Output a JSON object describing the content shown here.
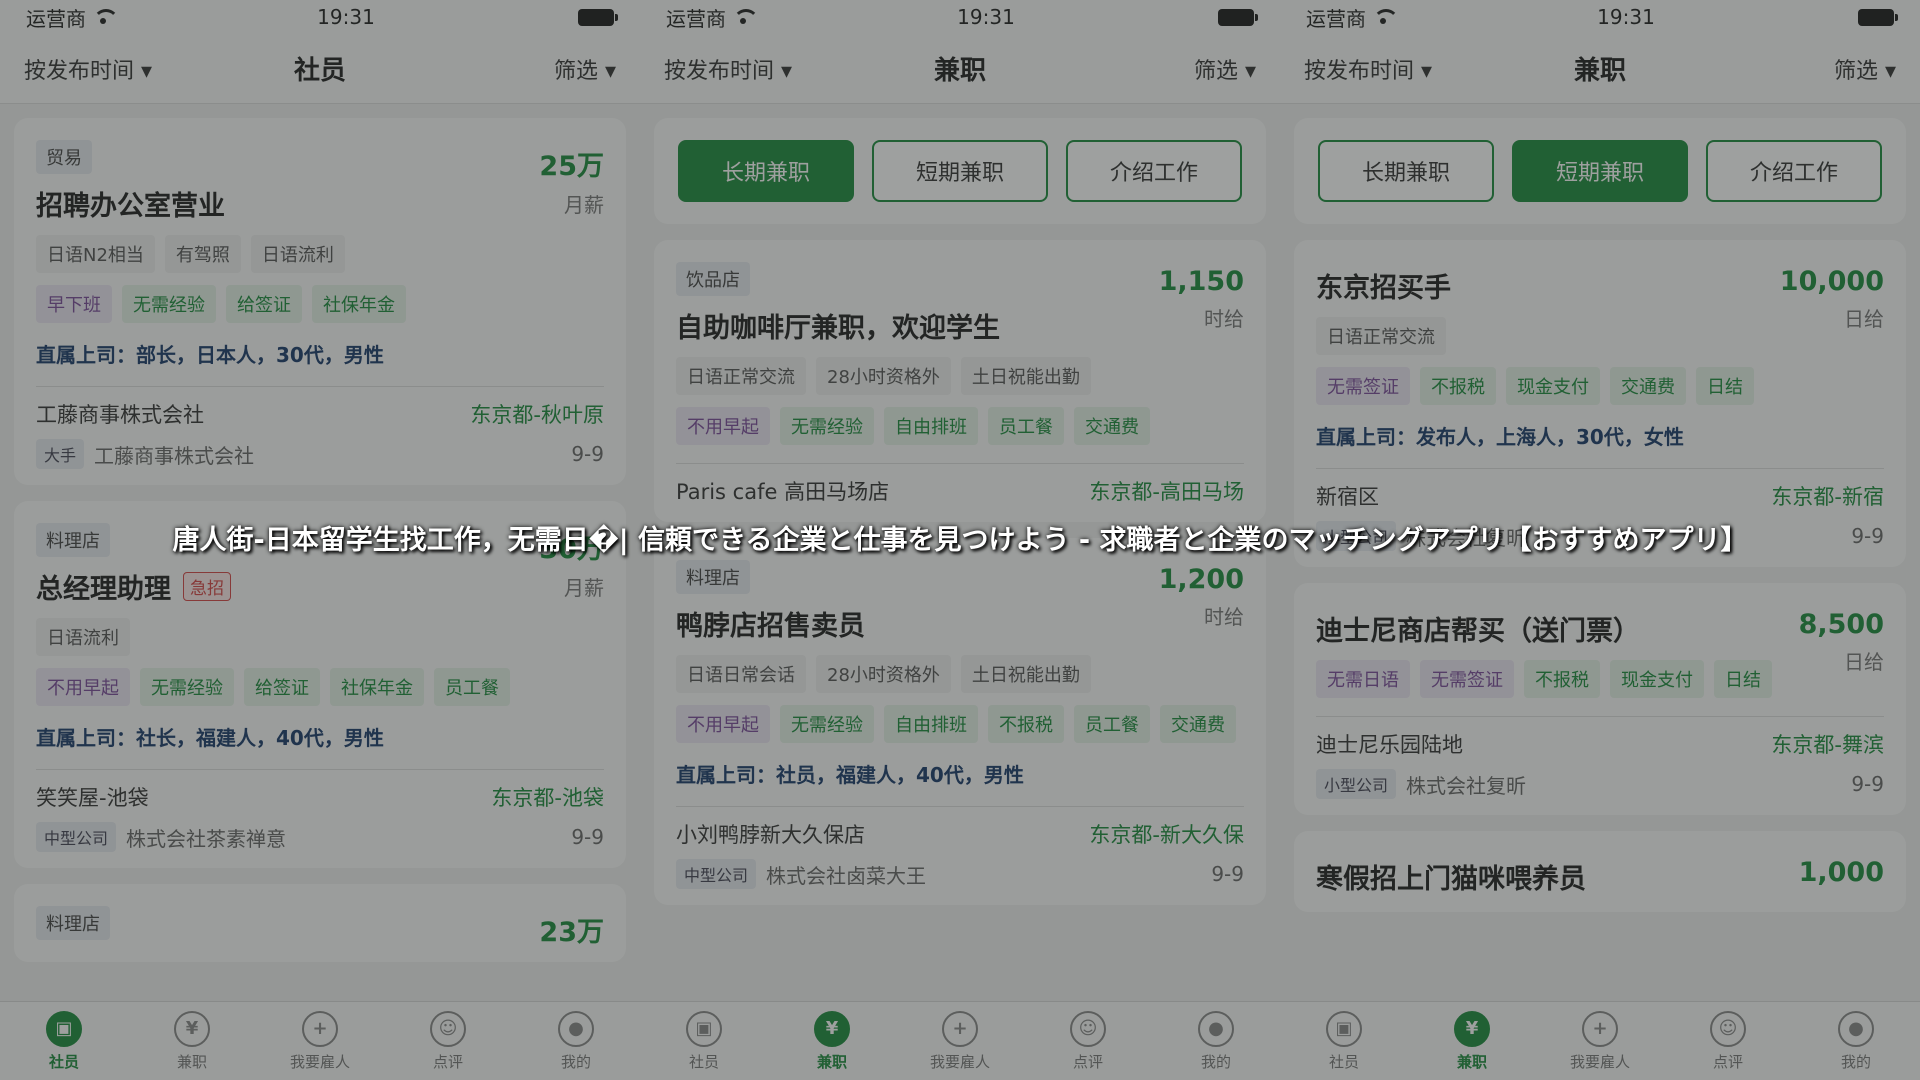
{
  "screens": [
    {
      "status": {
        "carrier": "运营商",
        "time": "19:31"
      },
      "nav": {
        "sort": "按发布时间 ▾",
        "title": "社员",
        "filter": "筛选 ▾"
      },
      "cards": [
        {
          "category": "贸易",
          "title": "招聘办公室营业",
          "salary": "25万",
          "unit": "月薪",
          "req_tags": [
            "日语N2相当",
            "有驾照",
            "日语流利"
          ],
          "benefit_tags": [
            {
              "t": "早下班",
              "c": "purple"
            },
            {
              "t": "无需经验",
              "c": "green"
            },
            {
              "t": "给签证",
              "c": "green"
            },
            {
              "t": "社保年金",
              "c": "green"
            }
          ],
          "boss": "直属上司：部长，日本人，30代，男性",
          "company": "工藤商事株式会社",
          "location": "东京都-秋叶原",
          "size": "大手",
          "company_full": "工藤商事株式会社",
          "hours": "9-9"
        },
        {
          "category": "料理店",
          "title": "总经理助理",
          "urgent": "急招",
          "salary": "30万",
          "unit": "月薪",
          "req_tags": [
            "日语流利"
          ],
          "benefit_tags": [
            {
              "t": "不用早起",
              "c": "purple"
            },
            {
              "t": "无需经验",
              "c": "green"
            },
            {
              "t": "给签证",
              "c": "green"
            },
            {
              "t": "社保年金",
              "c": "green"
            },
            {
              "t": "员工餐",
              "c": "green"
            }
          ],
          "boss": "直属上司：社长，福建人，40代，男性",
          "company": "笑笑屋-池袋",
          "location": "东京都-池袋",
          "size": "中型公司",
          "company_full": "株式会社茶素禅意",
          "hours": "9-9"
        },
        {
          "category": "料理店",
          "salary": "23万"
        }
      ],
      "tabs": [
        {
          "label": "社员",
          "icon": "bag-icon",
          "glyph": "▣"
        },
        {
          "label": "兼职",
          "icon": "yen-icon",
          "glyph": "¥"
        },
        {
          "label": "我要雇人",
          "icon": "plus-icon",
          "glyph": "+"
        },
        {
          "label": "点评",
          "icon": "smile-icon",
          "glyph": "☺"
        },
        {
          "label": "我的",
          "icon": "user-icon",
          "glyph": "●"
        }
      ],
      "active_tab": 0
    },
    {
      "status": {
        "carrier": "运营商",
        "time": "19:31"
      },
      "nav": {
        "sort": "按发布时间 ▾",
        "title": "兼职",
        "filter": "筛选 ▾"
      },
      "segments": [
        "长期兼职",
        "短期兼职",
        "介绍工作"
      ],
      "active_segment": 0,
      "cards": [
        {
          "category": "饮品店",
          "title": "自助咖啡厅兼职，欢迎学生",
          "salary": "1,150",
          "unit": "时给",
          "req_tags": [
            "日语正常交流",
            "28小时资格外",
            "土日祝能出勤"
          ],
          "benefit_tags": [
            {
              "t": "不用早起",
              "c": "purple"
            },
            {
              "t": "无需经验",
              "c": "green"
            },
            {
              "t": "自由排班",
              "c": "green"
            },
            {
              "t": "员工餐",
              "c": "green"
            },
            {
              "t": "交通费",
              "c": "green"
            }
          ],
          "company": "Paris cafe 高田马场店",
          "location": "东京都-高田马场"
        },
        {
          "category": "料理店",
          "title": "鸭脖店招售卖员",
          "salary": "1,200",
          "unit": "时给",
          "req_tags": [
            "日语日常会话",
            "28小时资格外",
            "土日祝能出勤"
          ],
          "benefit_tags": [
            {
              "t": "不用早起",
              "c": "purple"
            },
            {
              "t": "无需经验",
              "c": "green"
            },
            {
              "t": "自由排班",
              "c": "green"
            },
            {
              "t": "不报税",
              "c": "green"
            },
            {
              "t": "员工餐",
              "c": "green"
            },
            {
              "t": "交通费",
              "c": "green"
            }
          ],
          "boss": "直属上司：社员，福建人，40代，男性",
          "company": "小刘鸭脖新大久保店",
          "location": "东京都-新大久保",
          "size": "中型公司",
          "company_full": "株式会社卤菜大王",
          "hours": "9-9"
        }
      ],
      "tabs": [
        {
          "label": "社员",
          "icon": "bag-icon",
          "glyph": "▣"
        },
        {
          "label": "兼职",
          "icon": "yen-icon",
          "glyph": "¥"
        },
        {
          "label": "我要雇人",
          "icon": "plus-icon",
          "glyph": "+"
        },
        {
          "label": "点评",
          "icon": "smile-icon",
          "glyph": "☺"
        },
        {
          "label": "我的",
          "icon": "user-icon",
          "glyph": "●"
        }
      ],
      "active_tab": 1
    },
    {
      "status": {
        "carrier": "运营商",
        "time": "19:31"
      },
      "nav": {
        "sort": "按发布时间 ▾",
        "title": "兼职",
        "filter": "筛选 ▾"
      },
      "segments": [
        "长期兼职",
        "短期兼职",
        "介绍工作"
      ],
      "active_segment": 1,
      "cards": [
        {
          "title": "东京招买手",
          "salary": "10,000",
          "unit": "日给",
          "req_tags": [
            "日语正常交流"
          ],
          "benefit_tags": [
            {
              "t": "无需签证",
              "c": "purple"
            },
            {
              "t": "不报税",
              "c": "green"
            },
            {
              "t": "现金支付",
              "c": "green"
            },
            {
              "t": "交通费",
              "c": "green"
            },
            {
              "t": "日结",
              "c": "green"
            }
          ],
          "boss": "直属上司：发布人，上海人，30代，女性",
          "company": "新宿区",
          "location": "东京都-新宿",
          "size": "小型公司",
          "company_full": "株式会社复昕",
          "hours": "9-9"
        },
        {
          "title": "迪士尼商店帮买（送门票）",
          "salary": "8,500",
          "unit": "日给",
          "benefit_tags": [
            {
              "t": "无需日语",
              "c": "purple"
            },
            {
              "t": "无需签证",
              "c": "purple"
            },
            {
              "t": "不报税",
              "c": "green"
            },
            {
              "t": "现金支付",
              "c": "green"
            },
            {
              "t": "日结",
              "c": "green"
            }
          ],
          "company": "迪士尼乐园陆地",
          "location": "东京都-舞滨",
          "size": "小型公司",
          "company_full": "株式会社复昕",
          "hours": "9-9"
        },
        {
          "title": "寒假招上门猫咪喂养员",
          "salary": "1,000"
        }
      ],
      "tabs": [
        {
          "label": "社员",
          "icon": "bag-icon",
          "glyph": "▣"
        },
        {
          "label": "兼职",
          "icon": "yen-icon",
          "glyph": "¥"
        },
        {
          "label": "我要雇人",
          "icon": "plus-icon",
          "glyph": "+"
        },
        {
          "label": "点评",
          "icon": "smile-icon",
          "glyph": "☺"
        },
        {
          "label": "我的",
          "icon": "user-icon",
          "glyph": "●"
        }
      ],
      "active_tab": 1
    }
  ],
  "banner": "唐人街-日本留学生找工作，无需日�| 信頼できる企業と仕事を見つけよう - 求職者と企業のマッチングアプリ【おすすめアプリ】"
}
